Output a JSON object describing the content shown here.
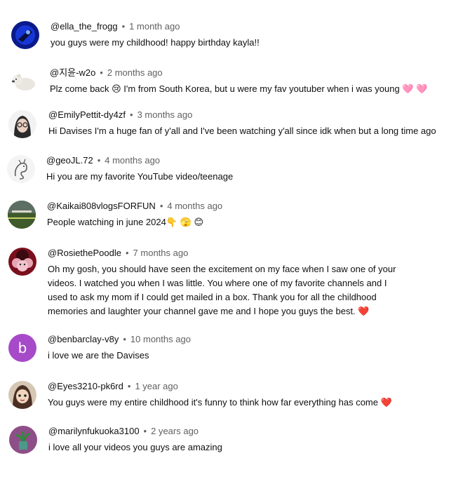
{
  "comments": [
    {
      "author": "@ella_the_frogg",
      "time": "1 month ago",
      "text": "you guys were my childhood! happy birthday kayla!!",
      "avatar_icon": "blue-light-avatar"
    },
    {
      "author": "@지윤-w2o",
      "time": "2 months ago",
      "text": "Plz come back 😢 I'm from South Korea, but u were my fav youtuber when i was young 🩷 🩷",
      "avatar_icon": "polar-bear-avatar"
    },
    {
      "author": "@EmilyPettit-dy4zf",
      "time": "3 months ago",
      "text": "Hi Davises I'm a huge fan of y'all and I've been watching y'all since idk when but a long time ago",
      "avatar_icon": "girl-glasses-avatar"
    },
    {
      "author": "@geoJL.72",
      "time": "4 months ago",
      "text": "Hi you are my favorite YouTube video/teenage",
      "avatar_icon": "dragon-sketch-avatar"
    },
    {
      "author": "@Kaikai808vlogsFORFUN",
      "time": "4 months ago",
      "text": "People watching in june 2024👇 🫣 😊",
      "avatar_icon": "field-photo-avatar"
    },
    {
      "author": "@RosiethePoodle",
      "time": "7 months ago",
      "text": "Oh my gosh, you should have seen the excitement on my face when I saw one of your videos. I watched you when I was little. You where one of my favorite channels and I used to ask my mom if I could get mailed in a box. Thank you for all the childhood memories and laughter your channel gave me and I hope you guys the best. ❤️",
      "avatar_icon": "poodle-avatar"
    },
    {
      "author": "@benbarclay-v8y",
      "time": "10 months ago",
      "text": "i love we are the Davises",
      "avatar_letter": "b",
      "avatar_color": "#a64ac9"
    },
    {
      "author": "@Eyes3210-pk6rd",
      "time": "1 year ago",
      "text": "You guys were my entire childhood it's funny to think how far everything has come ❤️",
      "avatar_icon": "cartoon-girl-avatar"
    },
    {
      "author": "@marilynfukuoka3100",
      "time": "2 years ago",
      "text": "i love all your videos you guys are amazing",
      "avatar_icon": "plant-pot-avatar"
    }
  ],
  "separator": "•"
}
